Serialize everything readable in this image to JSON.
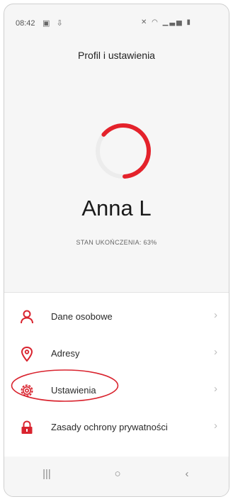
{
  "status_bar": {
    "time": "08:42",
    "left_icons": [
      "gallery-icon",
      "download-icon"
    ],
    "right_icons": [
      "mute-icon",
      "wifi-icon",
      "signal-icon",
      "battery-icon"
    ]
  },
  "header": {
    "title": "Profil i ustawienia"
  },
  "profile": {
    "name": "Anna L",
    "completion_label": "STAN UKOŃCZENIA:",
    "completion_value": "63%",
    "completion_fraction": 0.63,
    "accent_color": "#e4222b",
    "track_color": "#ececec"
  },
  "menu": {
    "items": [
      {
        "label": "Dane osobowe",
        "icon": "person-icon"
      },
      {
        "label": "Adresy",
        "icon": "location-pin-icon"
      },
      {
        "label": "Ustawienia",
        "icon": "gear-icon"
      },
      {
        "label": "Zasady ochrony prywatności",
        "icon": "lock-icon"
      }
    ],
    "chevron": "›"
  },
  "highlight": {
    "target": "Ustawienia",
    "color": "#d9232e"
  },
  "nav_bar": {
    "recents": "|||",
    "home": "○",
    "back": "‹"
  }
}
